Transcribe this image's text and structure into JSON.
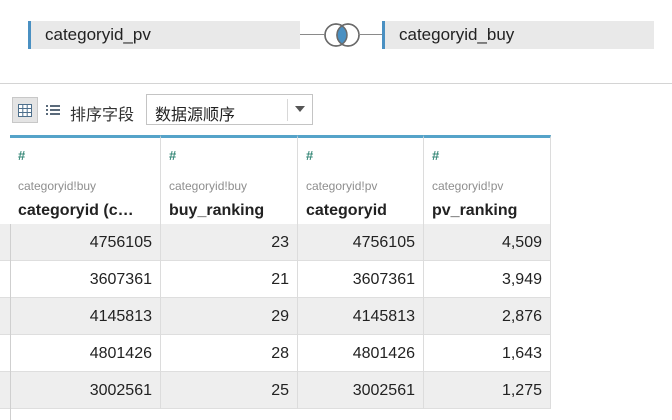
{
  "join": {
    "left_source": "categoryid_pv",
    "right_source": "categoryid_buy",
    "join_type_icon": "inner-join-venn-icon",
    "accent_color": "#4a90c2"
  },
  "toolbar": {
    "grid_view_icon": "grid-view-icon",
    "list_view_icon": "list-view-icon",
    "sort_label": "排序字段",
    "sort_value": "数据源顺序"
  },
  "table": {
    "columns": [
      {
        "type_icon": "#",
        "source": "categoryid!buy",
        "name": "categoryid (c…"
      },
      {
        "type_icon": "#",
        "source": "categoryid!buy",
        "name": "buy_ranking"
      },
      {
        "type_icon": "#",
        "source": "categoryid!pv",
        "name": "categoryid"
      },
      {
        "type_icon": "#",
        "source": "categoryid!pv",
        "name": "pv_ranking"
      }
    ],
    "rows": [
      [
        "4756105",
        "23",
        "4756105",
        "4,509"
      ],
      [
        "3607361",
        "21",
        "3607361",
        "3,949"
      ],
      [
        "4145813",
        "29",
        "4145813",
        "2,876"
      ],
      [
        "4801426",
        "28",
        "4801426",
        "1,643"
      ],
      [
        "3002561",
        "25",
        "3002561",
        "1,275"
      ]
    ]
  }
}
